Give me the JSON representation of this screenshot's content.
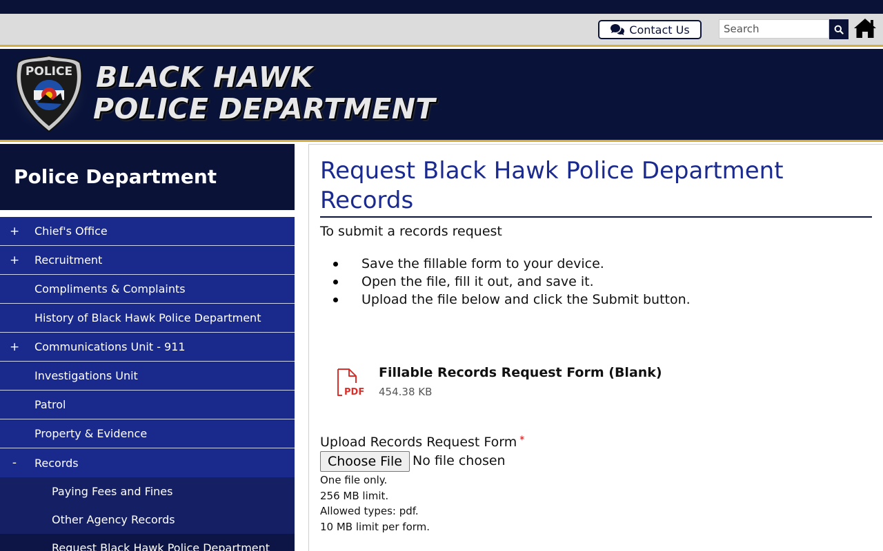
{
  "utility": {
    "contact_label": "Contact Us",
    "search_placeholder": "Search"
  },
  "banner": {
    "line1": "BLACK HAWK",
    "line2": "POLICE DEPARTMENT",
    "badge_text": "POLICE"
  },
  "sidebar": {
    "title": "Police Department",
    "items": [
      {
        "toggle": "+",
        "label": "Chief's Office"
      },
      {
        "toggle": "+",
        "label": "Recruitment"
      },
      {
        "toggle": "",
        "label": "Compliments & Complaints"
      },
      {
        "toggle": "",
        "label": "History of Black Hawk Police Department"
      },
      {
        "toggle": "+",
        "label": "Communications Unit - 911"
      },
      {
        "toggle": "",
        "label": "Investigations Unit"
      },
      {
        "toggle": "",
        "label": "Patrol"
      },
      {
        "toggle": "",
        "label": "Property & Evidence"
      },
      {
        "toggle": "-",
        "label": "Records"
      }
    ],
    "sub_items": [
      {
        "label": "Paying Fees and Fines"
      },
      {
        "label": "Other Agency Records"
      },
      {
        "label": "Request Black Hawk Police Department"
      }
    ]
  },
  "main": {
    "title": "Request Black Hawk Police Department Records",
    "intro": "To submit a records request",
    "steps": [
      "Save the fillable form to your device.",
      "Open the file, fill it out, and save it.",
      "Upload the file below and click the Submit button."
    ],
    "file": {
      "name": "Fillable Records Request Form (Blank)",
      "size": "454.38 KB",
      "icon_text": "PDF"
    },
    "upload": {
      "label": "Upload Records Request Form",
      "required_mark": "*",
      "button": "Choose File",
      "status": "No file chosen",
      "help": [
        "One file only.",
        "256 MB limit.",
        "Allowed types: pdf.",
        "10 MB limit per form."
      ]
    }
  },
  "colors": {
    "navy": "#0b1237",
    "nav_blue": "#1a2a8c",
    "title_blue": "#1b2a8e",
    "gold": "#d4ad3a",
    "pdf_red": "#d9302c"
  }
}
